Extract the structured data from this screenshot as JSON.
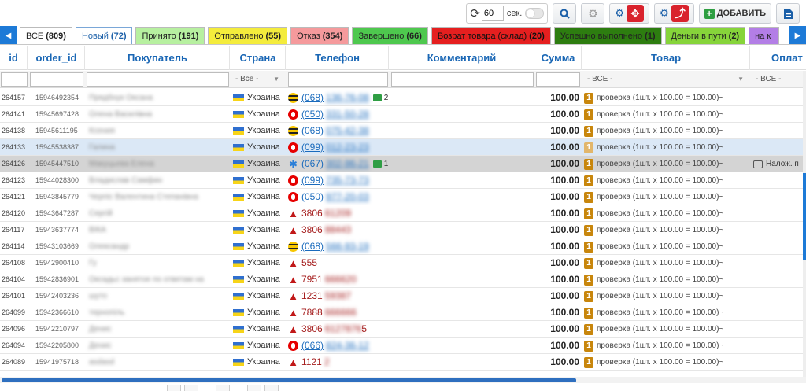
{
  "toolbar": {
    "refresh_seconds": "60",
    "seconds_label": "сек.",
    "add_label": "ДОБАВИТЬ",
    "icons": [
      "refresh-icon",
      "search-icon",
      "settings-icon",
      "cogs-icon",
      "move-icon",
      "cogs-icon",
      "fork-icon",
      "plus-icon",
      "document-icon"
    ]
  },
  "tabs": [
    {
      "label": "ВСЕ",
      "count": "(809)",
      "bg": "#ffffff"
    },
    {
      "label": "Новый",
      "count": "(72)",
      "bg": "#ffffff",
      "active": true
    },
    {
      "label": "Принято",
      "count": "(191)",
      "bg": "#b7f0a0"
    },
    {
      "label": "Отправлено",
      "count": "(55)",
      "bg": "#f4ec3c"
    },
    {
      "label": "Отказ",
      "count": "(354)",
      "bg": "#f59a9c"
    },
    {
      "label": "Завершено",
      "count": "(66)",
      "bg": "#4ec84e"
    },
    {
      "label": "Возрат товара (склад)",
      "count": "(20)",
      "bg": "#e51f1f"
    },
    {
      "label": "Успешно выполнено",
      "count": "(1)",
      "bg": "#2d7d10"
    },
    {
      "label": "Деньги в пути",
      "count": "(2)",
      "bg": "#86d43a"
    },
    {
      "label": "на к",
      "count": "",
      "bg": "#b37ee6"
    }
  ],
  "columns": {
    "id": "id",
    "order_id": "order_id",
    "buyer": "Покупатель",
    "country": "Страна",
    "phone": "Телефон",
    "comment": "Комментарий",
    "sum": "Сумма",
    "goods": "Товар",
    "payment": "Оплат"
  },
  "filters": {
    "country": "- Все -",
    "goods": "- ВСЕ -",
    "payment": "- ВСЕ -"
  },
  "rows": [
    {
      "id": "264157",
      "order_id": "15946492354",
      "buyer": "Прядбнук Оксана",
      "country": "Украина",
      "operator": "beeline",
      "phone": "(068)",
      "phone_hidden": "136-76-08",
      "sms": "2",
      "sum": "100.00",
      "qty": "1",
      "goods": "проверка (1шт. x 100.00 = 100.00)~",
      "payment": ""
    },
    {
      "id": "264141",
      "order_id": "15945697428",
      "buyer": "Олена Василівна",
      "country": "Украина",
      "operator": "vodafone",
      "phone": "(050)",
      "phone_hidden": "331-50-28",
      "sms": "",
      "sum": "100.00",
      "qty": "1",
      "goods": "проверка (1шт. x 100.00 = 100.00)~",
      "payment": ""
    },
    {
      "id": "264138",
      "order_id": "15945611195",
      "buyer": "Ксения",
      "country": "Украина",
      "operator": "beeline",
      "phone": "(068)",
      "phone_hidden": "075-42-38",
      "sms": "",
      "sum": "100.00",
      "qty": "1",
      "goods": "проверка (1шт. x 100.00 = 100.00)~",
      "payment": ""
    },
    {
      "id": "264133",
      "order_id": "15945538387",
      "buyer": "Галина",
      "country": "Украина",
      "operator": "vodafone",
      "phone": "(099)",
      "phone_hidden": "012-23-23",
      "sms": "",
      "sum": "100.00",
      "qty": "1",
      "goods": "проверка (1шт. x 100.00 = 100.00)~",
      "payment": "",
      "highlight": "hl1"
    },
    {
      "id": "264126",
      "order_id": "15945447510",
      "buyer": "Макуцьева Елена",
      "country": "Украина",
      "operator": "kyivstar",
      "phone": "(067)",
      "phone_hidden": "302-96-21",
      "sms": "1",
      "sum": "100.00",
      "qty": "1",
      "goods": "проверка (1шт. x 100.00 = 100.00)~",
      "payment": "Налож. п",
      "highlight": "hl2"
    },
    {
      "id": "264123",
      "order_id": "15944028300",
      "buyer": "Владислав Самфин",
      "country": "Украина",
      "operator": "vodafone",
      "phone": "(099)",
      "phone_hidden": "735-73-73",
      "sms": "",
      "sum": "100.00",
      "qty": "1",
      "goods": "проверка (1шт. x 100.00 = 100.00)~",
      "payment": ""
    },
    {
      "id": "264121",
      "order_id": "15943845779",
      "buyer": "Черпіс Валентина Степанівна",
      "country": "Украина",
      "operator": "vodafone",
      "phone": "(050)",
      "phone_hidden": "977-20-03",
      "sms": "",
      "sum": "100.00",
      "qty": "1",
      "goods": "проверка (1шт. x 100.00 = 100.00)~",
      "payment": ""
    },
    {
      "id": "264120",
      "order_id": "15943647287",
      "buyer": "Сергій",
      "country": "Украина",
      "operator": "warning",
      "phone": "3806",
      "phone_hidden": "61209",
      "sms": "",
      "sum": "100.00",
      "qty": "1",
      "goods": "проверка (1шт. x 100.00 = 100.00)~",
      "payment": ""
    },
    {
      "id": "264117",
      "order_id": "15943637774",
      "buyer": "ВІКА",
      "country": "Украина",
      "operator": "warning",
      "phone": "3806",
      "phone_hidden": "88443",
      "sms": "",
      "sum": "100.00",
      "qty": "1",
      "goods": "проверка (1шт. x 100.00 = 100.00)~",
      "payment": ""
    },
    {
      "id": "264114",
      "order_id": "15943103669",
      "buyer": "Олександр",
      "country": "Украина",
      "operator": "beeline",
      "phone": "(068)",
      "phone_hidden": "566-93-19",
      "sms": "",
      "sum": "100.00",
      "qty": "1",
      "goods": "проверка (1шт. x 100.00 = 100.00)~",
      "payment": ""
    },
    {
      "id": "264108",
      "order_id": "15942900410",
      "buyer": "Гу",
      "country": "Украина",
      "operator": "warning",
      "phone": "555",
      "phone_hidden": "",
      "sms": "",
      "sum": "100.00",
      "qty": "1",
      "goods": "проверка (1шт. x 100.00 = 100.00)~",
      "payment": ""
    },
    {
      "id": "264104",
      "order_id": "15942836901",
      "buyer": "Оксадьс занятое по ответам на",
      "country": "Украина",
      "operator": "warning",
      "phone": "7951",
      "phone_hidden": "666620",
      "sms": "",
      "sum": "100.00",
      "qty": "1",
      "goods": "проверка (1шт. x 100.00 = 100.00)~",
      "payment": ""
    },
    {
      "id": "264101",
      "order_id": "15942403236",
      "buyer": "шуто",
      "country": "Украина",
      "operator": "warning",
      "phone": "1231",
      "phone_hidden": "59387",
      "sms": "",
      "sum": "100.00",
      "qty": "1",
      "goods": "проверка (1шт. x 100.00 = 100.00)~",
      "payment": ""
    },
    {
      "id": "264099",
      "order_id": "15942366610",
      "buyer": "тернопіль",
      "country": "Украина",
      "operator": "warning",
      "phone": "7888",
      "phone_hidden": "666666",
      "sms": "",
      "sum": "100.00",
      "qty": "1",
      "goods": "проверка (1шт. x 100.00 = 100.00)~",
      "payment": ""
    },
    {
      "id": "264096",
      "order_id": "15942210797",
      "buyer": "Денис",
      "country": "Украина",
      "operator": "warning",
      "phone": "3806",
      "phone_hidden": "6127876",
      "phone_tail": "5",
      "sms": "",
      "sum": "100.00",
      "qty": "1",
      "goods": "проверка (1шт. x 100.00 = 100.00)~",
      "payment": ""
    },
    {
      "id": "264094",
      "order_id": "15942205800",
      "buyer": "Денис",
      "country": "Украина",
      "operator": "vodafone",
      "phone": "(066)",
      "phone_hidden": "824-36-12",
      "sms": "",
      "sum": "100.00",
      "qty": "1",
      "goods": "проверка (1шт. x 100.00 = 100.00)~",
      "payment": ""
    },
    {
      "id": "264089",
      "order_id": "15941975718",
      "buyer": "asdasd",
      "country": "Украина",
      "operator": "warning",
      "phone": "1121",
      "phone_hidden": "2",
      "sms": "",
      "sum": "100.00",
      "qty": "1",
      "goods": "проверка (1шт. x 100.00 = 100.00)~",
      "payment": ""
    }
  ],
  "colors": {
    "accent": "#1d7ad7",
    "header_text": "#1a67b5",
    "warn": "#c11818",
    "qty_badge": "#c8860c"
  }
}
